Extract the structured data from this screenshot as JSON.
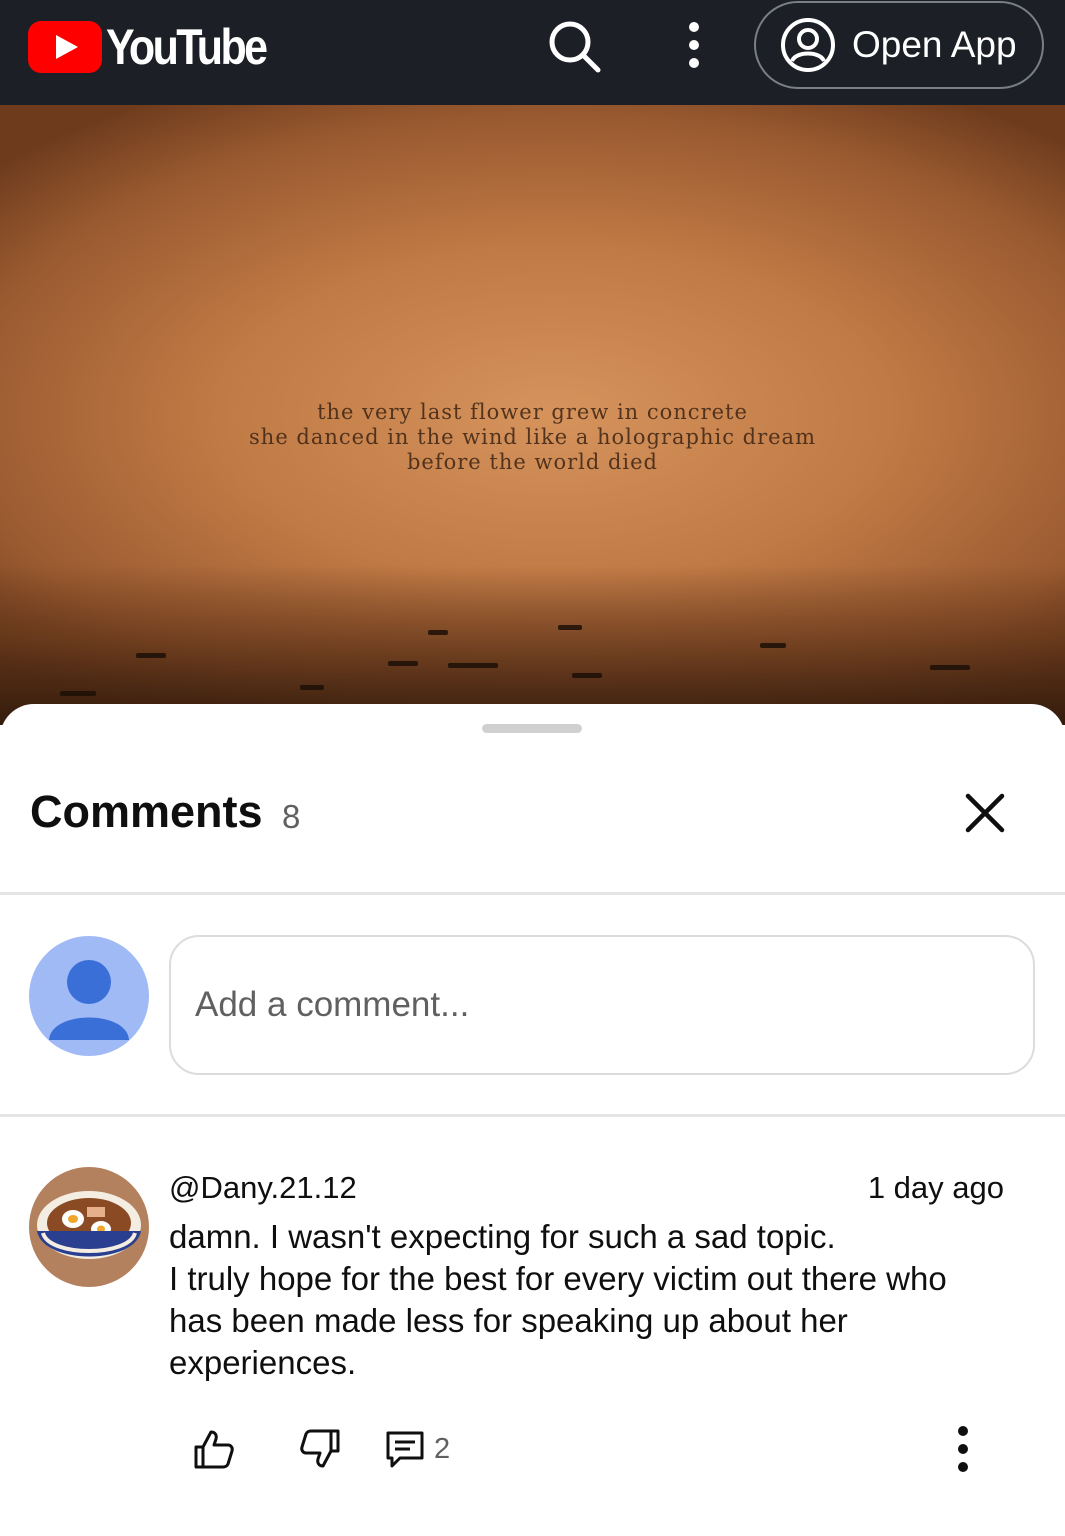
{
  "topbar": {
    "brand": "YouTube",
    "open_app_label": "Open App",
    "icons": [
      "youtube-logo-icon",
      "search-icon",
      "more-vertical-icon",
      "account-circle-icon"
    ],
    "background_color": "#1c1f26",
    "brand_color": "#ff0000"
  },
  "video": {
    "caption_lines": [
      "the very last flower grew in concrete",
      "she danced in the wind like a holographic dream",
      "before the world died"
    ]
  },
  "comments_sheet": {
    "title": "Comments",
    "count": "8",
    "close_icon": "close-icon",
    "add_comment_placeholder": "Add a comment...",
    "my_avatar_icon": "default-avatar-icon",
    "comments": [
      {
        "author": "@Dany.21.12",
        "time": "1 day ago",
        "body_lines": [
          "damn. I wasn't expecting for such a sad topic.",
          "I truly hope for the best for every victim out there who",
          "has been made less for speaking up about her",
          "experiences."
        ],
        "reply_count": "2",
        "icons": [
          "thumbs-up-icon",
          "thumbs-down-icon",
          "reply-icon",
          "more-vertical-icon"
        ]
      }
    ]
  }
}
